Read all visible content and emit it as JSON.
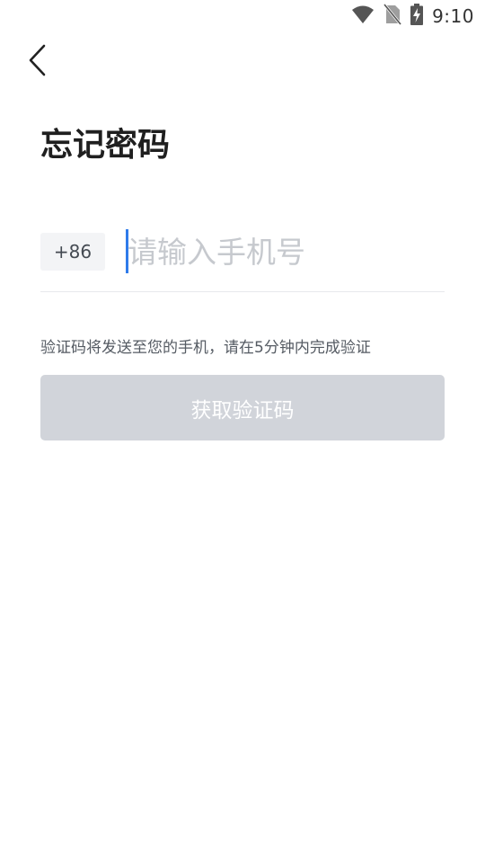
{
  "status_bar": {
    "time": "9:10",
    "icons": [
      "wifi-icon",
      "no-sim-icon",
      "battery-charging-icon"
    ]
  },
  "header": {
    "back_icon": "chevron-left-icon",
    "title": "忘记密码"
  },
  "phone": {
    "country_code": "+86",
    "placeholder": "请输入手机号",
    "value": ""
  },
  "hint": "验证码将发送至您的手机，请在5分钟内完成验证",
  "button": {
    "label": "获取验证码",
    "background": "#d1d4da",
    "enabled": false
  },
  "colors": {
    "cursor": "#2f7bea",
    "title": "#1f1f1f"
  }
}
